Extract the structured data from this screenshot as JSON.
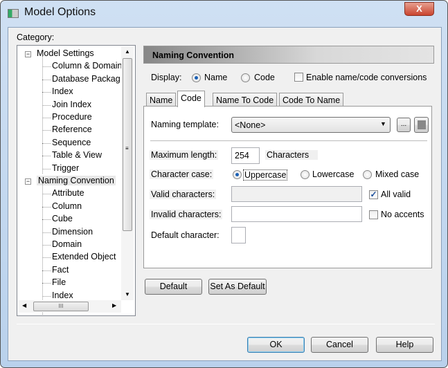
{
  "window": {
    "title": "Model Options",
    "close_label": "X"
  },
  "category_label": "Category:",
  "tree": {
    "items": [
      {
        "label": "Model Settings",
        "level": 0,
        "expanded": true
      },
      {
        "label": "Column & Domain",
        "level": 1
      },
      {
        "label": "Database Packag",
        "level": 1
      },
      {
        "label": "Index",
        "level": 1
      },
      {
        "label": "Join Index",
        "level": 1
      },
      {
        "label": "Procedure",
        "level": 1
      },
      {
        "label": "Reference",
        "level": 1
      },
      {
        "label": "Sequence",
        "level": 1
      },
      {
        "label": "Table & View",
        "level": 1
      },
      {
        "label": "Trigger",
        "level": 1
      },
      {
        "label": "Naming Convention",
        "level": 0,
        "expanded": true,
        "selected": true
      },
      {
        "label": "Attribute",
        "level": 1
      },
      {
        "label": "Column",
        "level": 1
      },
      {
        "label": "Cube",
        "level": 1
      },
      {
        "label": "Dimension",
        "level": 1
      },
      {
        "label": "Domain",
        "level": 1
      },
      {
        "label": "Extended Object",
        "level": 1
      },
      {
        "label": "Fact",
        "level": 1
      },
      {
        "label": "File",
        "level": 1
      },
      {
        "label": "Index",
        "level": 1
      }
    ]
  },
  "section_header": "Naming Convention",
  "display": {
    "label": "Display:",
    "options": [
      "Name",
      "Code"
    ],
    "selected": "Name",
    "enable_conversions_label": "Enable name/code conversions",
    "enable_conversions": false
  },
  "tabs": [
    {
      "label": "Name"
    },
    {
      "label": "Code",
      "selected": true
    },
    {
      "label": "Name To Code"
    },
    {
      "label": "Code To Name"
    }
  ],
  "form": {
    "naming_template_label": "Naming template:",
    "naming_template_value": "<None>",
    "browse_label": "...",
    "max_length_label": "Maximum length:",
    "max_length_value": "254",
    "max_length_unit": "Characters",
    "char_case_label": "Character case:",
    "char_case_options": [
      "Uppercase",
      "Lowercase",
      "Mixed case"
    ],
    "char_case_selected": "Uppercase",
    "valid_chars_label": "Valid characters:",
    "valid_chars_value": "",
    "all_valid_label": "All valid",
    "all_valid": true,
    "invalid_chars_label": "Invalid characters:",
    "invalid_chars_value": "",
    "no_accents_label": "No accents",
    "no_accents": false,
    "default_char_label": "Default character:",
    "default_char_value": ""
  },
  "buttons": {
    "default": "Default",
    "set_as_default": "Set As Default",
    "ok": "OK",
    "cancel": "Cancel",
    "help": "Help"
  }
}
